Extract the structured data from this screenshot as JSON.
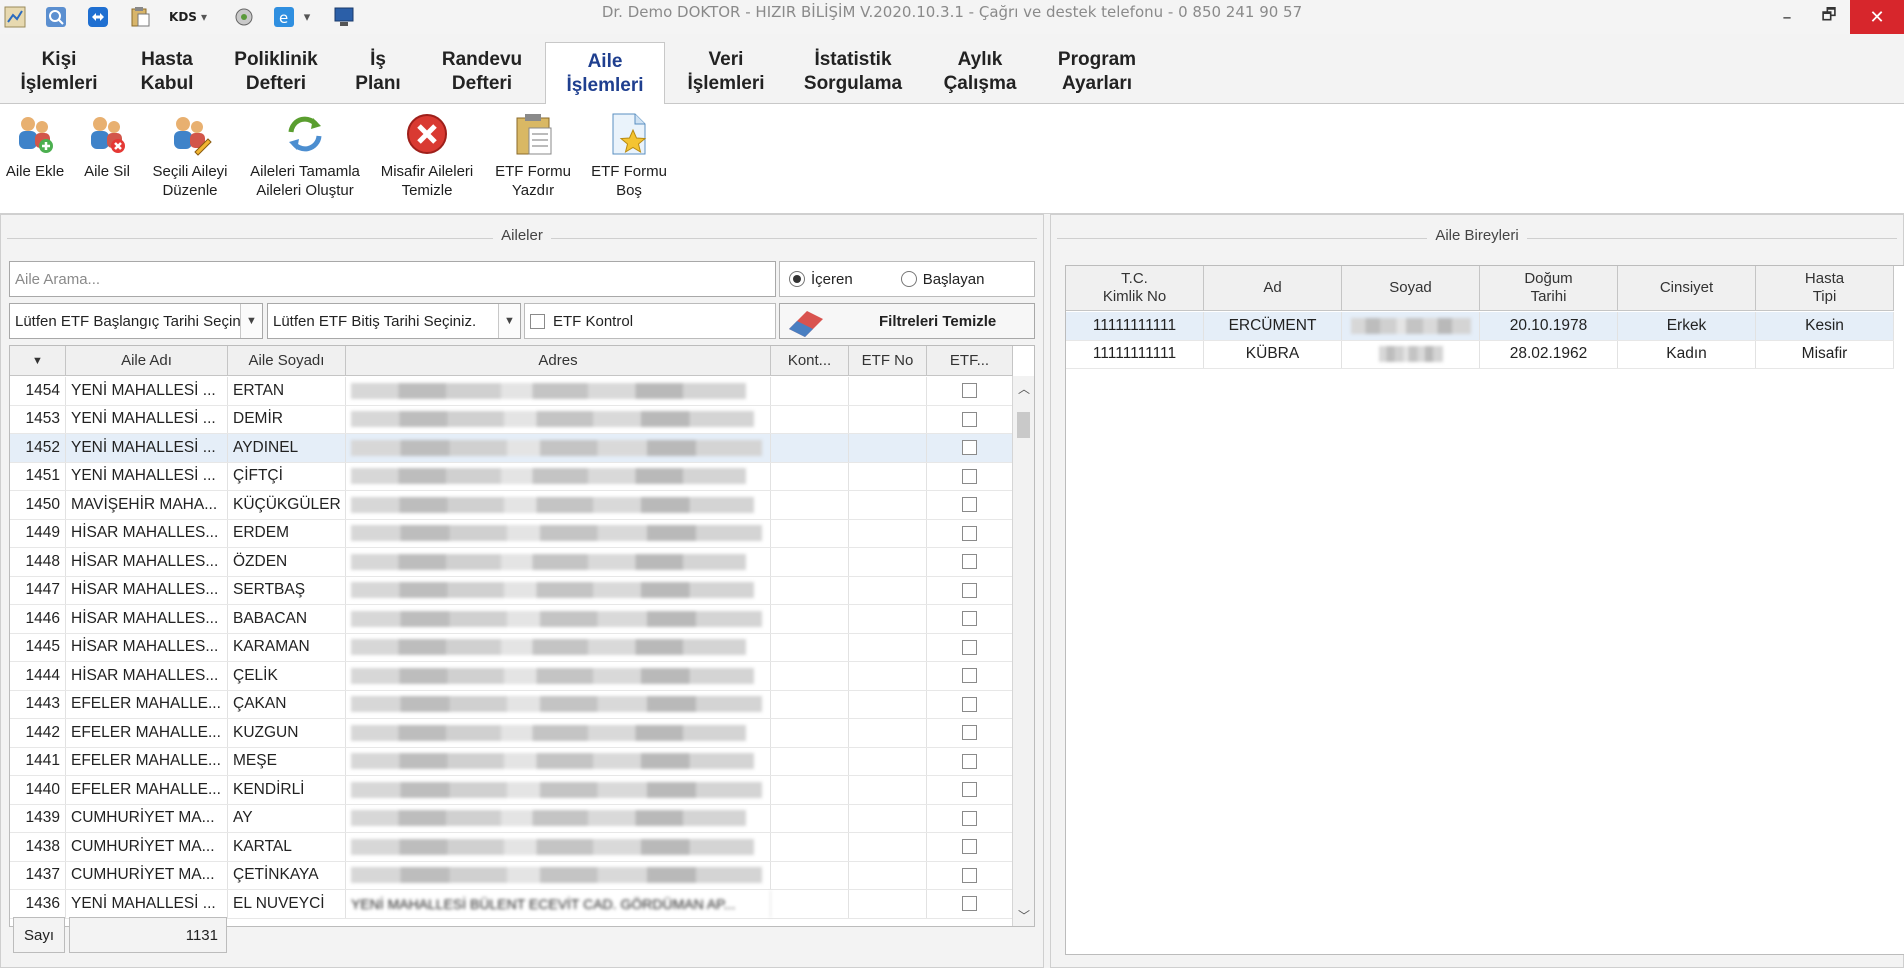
{
  "window": {
    "title": "Dr. Demo DOKTOR - HIZIR BİLİŞİM V.2020.10.3.1 - Çağrı ve destek telefonu - 0 850 241 90 57",
    "minimize": "–",
    "restore": "🗗",
    "close": "✕"
  },
  "quick_access": {
    "kds_label": "KDS",
    "dropdown_glyph": "▾"
  },
  "tabs": [
    {
      "label": "Kişi\nİşlemleri"
    },
    {
      "label": "Hasta\nKabul"
    },
    {
      "label": "Poliklinik\nDefteri"
    },
    {
      "label": "İş\nPlanı"
    },
    {
      "label": "Randevu\nDefteri"
    },
    {
      "label": "Aile\nİşlemleri",
      "active": true
    },
    {
      "label": "Veri\nİşlemleri"
    },
    {
      "label": "İstatistik\nSorgulama"
    },
    {
      "label": "Aylık\nÇalışma"
    },
    {
      "label": "Program\nAyarları"
    }
  ],
  "ribbon": [
    {
      "label": "Aile Ekle",
      "icon": "family-add-icon"
    },
    {
      "label": "Aile Sil",
      "icon": "family-delete-icon"
    },
    {
      "label": "Seçili Aileyi\nDüzenle",
      "icon": "family-edit-icon"
    },
    {
      "label": "Aileleri Tamamla\nAileleri Oluştur",
      "icon": "refresh-icon"
    },
    {
      "label": "Misafir Aileleri\nTemizle",
      "icon": "delete-red-icon"
    },
    {
      "label": "ETF Formu\nYazdır",
      "icon": "form-print-icon"
    },
    {
      "label": "ETF Formu\nBoş",
      "icon": "form-star-icon"
    }
  ],
  "families_panel": {
    "title": "Aileler",
    "search_placeholder": "Aile Arama...",
    "radio_contains": "İçeren",
    "radio_starts": "Başlayan",
    "start_date_placeholder": "Lütfen ETF Başlangıç Tarihi Seçiniz.",
    "end_date_placeholder": "Lütfen ETF Bitiş Tarihi Seçiniz.",
    "etf_control": "ETF Kontrol",
    "clear_filters": "Filtreleri Temizle",
    "columns": [
      "▼",
      "Aile Adı",
      "Aile Soyadı",
      "Adres",
      "Kont...",
      "ETF No",
      "ETF..."
    ],
    "rows": [
      {
        "id": "1454",
        "name": "YENİ MAHALLESİ ...",
        "surname": "ERTAN"
      },
      {
        "id": "1453",
        "name": "YENİ MAHALLESİ ...",
        "surname": "DEMİR"
      },
      {
        "id": "1452",
        "name": "YENİ MAHALLESİ ...",
        "surname": "AYDINEL",
        "selected": true
      },
      {
        "id": "1451",
        "name": "YENİ MAHALLESİ ...",
        "surname": "ÇİFTÇİ"
      },
      {
        "id": "1450",
        "name": "MAVİŞEHİR MAHA...",
        "surname": "KÜÇÜKGÜLER"
      },
      {
        "id": "1449",
        "name": "HİSAR MAHALLES...",
        "surname": "ERDEM"
      },
      {
        "id": "1448",
        "name": "HİSAR MAHALLES...",
        "surname": "ÖZDEN"
      },
      {
        "id": "1447",
        "name": "HİSAR MAHALLES...",
        "surname": "SERTBAŞ"
      },
      {
        "id": "1446",
        "name": "HİSAR MAHALLES...",
        "surname": "BABACAN"
      },
      {
        "id": "1445",
        "name": "HİSAR MAHALLES...",
        "surname": "KARAMAN"
      },
      {
        "id": "1444",
        "name": "HİSAR MAHALLES...",
        "surname": "ÇELİK"
      },
      {
        "id": "1443",
        "name": "EFELER MAHALLE...",
        "surname": "ÇAKAN"
      },
      {
        "id": "1442",
        "name": "EFELER MAHALLE...",
        "surname": "KUZGUN"
      },
      {
        "id": "1441",
        "name": "EFELER MAHALLE...",
        "surname": "MEŞE"
      },
      {
        "id": "1440",
        "name": "EFELER MAHALLE...",
        "surname": "KENDİRLİ"
      },
      {
        "id": "1439",
        "name": "CUMHURİYET MA...",
        "surname": "AY"
      },
      {
        "id": "1438",
        "name": "CUMHURİYET MA...",
        "surname": "KARTAL"
      },
      {
        "id": "1437",
        "name": "CUMHURİYET MA...",
        "surname": "ÇETİNKAYA"
      },
      {
        "id": "1436",
        "name": "YENİ MAHALLESİ ...",
        "surname": "EL NUVEYCİ",
        "address": "YENİ MAHALLESİ BÜLENT ECEVİT CAD. GÖRDÜMAN AP..."
      }
    ],
    "count_label": "Sayı",
    "count_value": "1131"
  },
  "members_panel": {
    "title": "Aile Bireyleri",
    "columns": [
      "T.C.\nKimlik No",
      "Ad",
      "Soyad",
      "Doğum\nTarihi",
      "Cinsiyet",
      "Hasta\nTipi"
    ],
    "rows": [
      {
        "tc": "11111111111",
        "name": "ERCÜMENT",
        "birth": "20.10.1978",
        "gender": "Erkek",
        "type": "Kesin",
        "selected": true
      },
      {
        "tc": "11111111111",
        "name": "KÜBRA",
        "birth": "28.02.1962",
        "gender": "Kadın",
        "type": "Misafir"
      }
    ]
  },
  "colors": {
    "accent": "#1f3f8f",
    "close": "#d7262c",
    "selection": "#e5eef8"
  }
}
